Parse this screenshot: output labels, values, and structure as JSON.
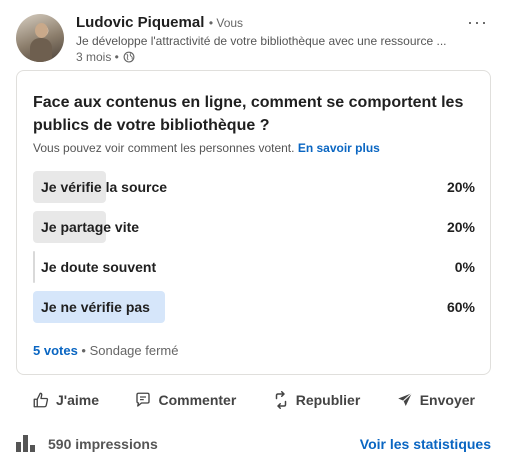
{
  "post": {
    "author_name": "Ludovic Piquemal",
    "author_relation": "• Vous",
    "headline": "Je développe l'attractivité de votre bibliothèque avec une ressource ...",
    "time_ago": "3 mois •",
    "visibility_icon": "globe-icon",
    "more_icon": "more-horizontal-icon"
  },
  "poll": {
    "question": "Face aux contenus en ligne, comment se comportent les publics de votre bibliothèque ?",
    "voters_note": "Vous pouvez voir comment les personnes votent.",
    "learn_more": "En savoir plus",
    "options": [
      {
        "label": "Je vérifie la source",
        "percent_text": "20%",
        "percent": 20,
        "selected": false
      },
      {
        "label": "Je partage vite",
        "percent_text": "20%",
        "percent": 20,
        "selected": false
      },
      {
        "label": "Je doute souvent",
        "percent_text": "0%",
        "percent": 0,
        "selected": false
      },
      {
        "label": "Je ne vérifie pas",
        "percent_text": "60%",
        "percent": 60,
        "selected": true
      }
    ],
    "votes": "5 votes",
    "status": " • Sondage fermé"
  },
  "actions": {
    "like": "J'aime",
    "comment": "Commenter",
    "repost": "Republier",
    "send": "Envoyer"
  },
  "stats": {
    "impressions": "590 impressions",
    "view_stats": "Voir les statistiques"
  },
  "colors": {
    "accent": "#0a66c2",
    "bar_default": "#e8e8e8",
    "bar_selected": "#d6e6fa"
  }
}
